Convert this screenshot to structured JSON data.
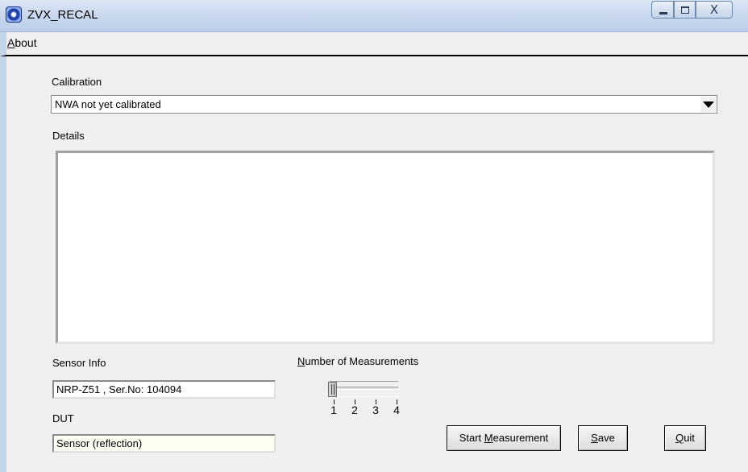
{
  "window": {
    "title": "ZVX_RECAL",
    "close_glyph": "X"
  },
  "menu": {
    "about": {
      "pre": "",
      "accel": "A",
      "post": "bout"
    }
  },
  "calibration": {
    "label": "Calibration",
    "selected": "NWA not yet calibrated"
  },
  "details": {
    "label": "Details",
    "text": ""
  },
  "sensor_info": {
    "label": "Sensor Info",
    "value": "NRP-Z51 , Ser.No: 104094"
  },
  "dut": {
    "label": "DUT",
    "value": "Sensor (reflection)"
  },
  "measurements": {
    "label_accel": "N",
    "label_rest": "umber of Measurements",
    "ticks": [
      "1",
      "2",
      "3",
      "4"
    ],
    "value": 1
  },
  "buttons": {
    "start": {
      "pre": "Start ",
      "accel": "M",
      "post": "easurement"
    },
    "save": {
      "pre": "",
      "accel": "S",
      "post": "ave"
    },
    "quit": {
      "pre": "",
      "accel": "Q",
      "post": "uit"
    }
  },
  "icons": {
    "app": "app-logo-icon",
    "minimize": "minimize-icon",
    "maximize": "maximize-icon",
    "close": "close-icon",
    "dropdown": "chevron-down-icon"
  }
}
